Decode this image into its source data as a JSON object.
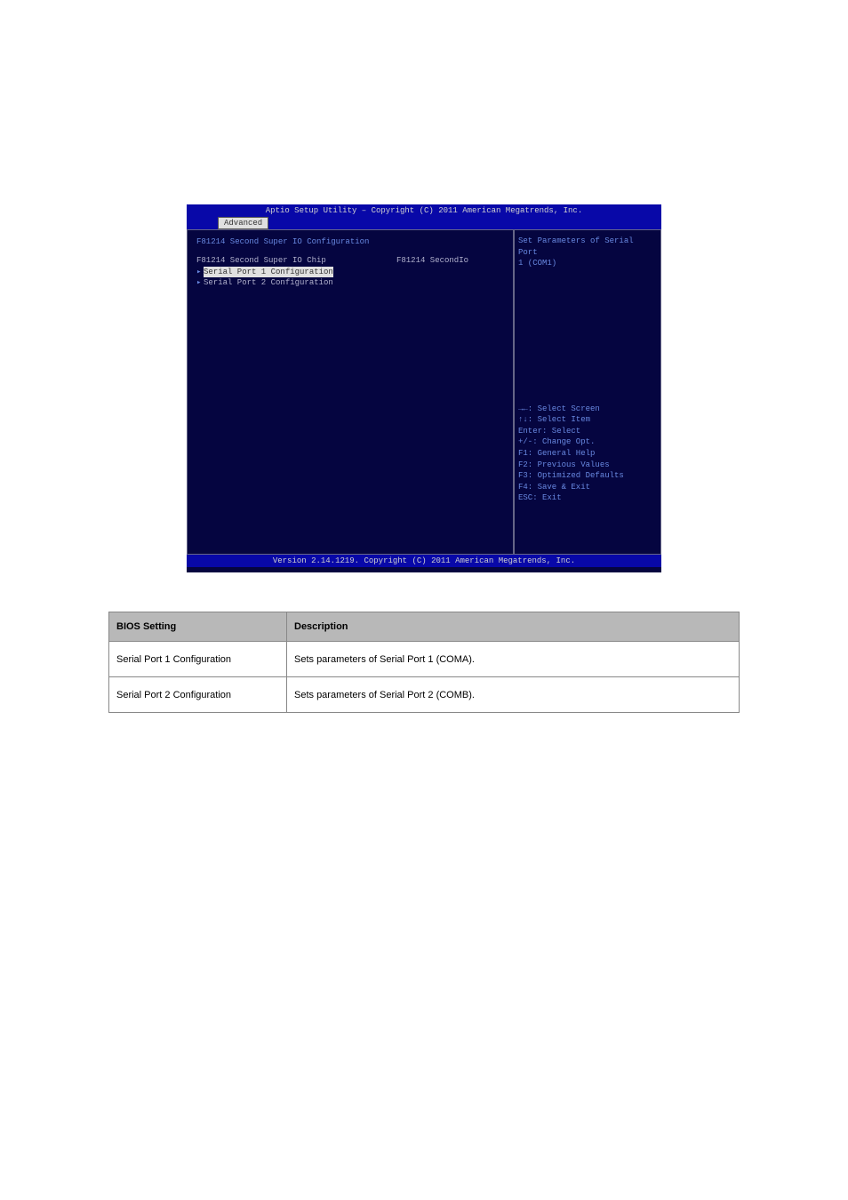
{
  "bios": {
    "title": "Aptio Setup Utility – Copyright (C) 2011 American Megatrends, Inc.",
    "tab": "Advanced",
    "section_heading": "F81214 Second Super IO Configuration",
    "chip_label": "F81214 Second Super IO Chip",
    "chip_value": "F81214 SecondIo",
    "menu_item1": "Serial Port 1 Configuration",
    "menu_item2": "Serial Port 2 Configuration",
    "help_text_line1": "Set Parameters of Serial Port",
    "help_text_line2": "1 (COM1)",
    "keys": {
      "k1": "→←: Select Screen",
      "k2": "↑↓: Select Item",
      "k3": "Enter: Select",
      "k4": "+/-: Change Opt.",
      "k5": "F1: General Help",
      "k6": "F2: Previous Values",
      "k7": "F3: Optimized Defaults",
      "k8": "F4: Save & Exit",
      "k9": "ESC: Exit"
    },
    "footer": "Version 2.14.1219. Copyright (C) 2011 American Megatrends, Inc."
  },
  "table": {
    "header1": "BIOS Setting",
    "header2": "Description",
    "row1_setting": "Serial Port 1 Configuration",
    "row1_desc": "Sets parameters of Serial Port 1 (COMA).",
    "row2_setting": "Serial Port 2 Configuration",
    "row2_desc": "Sets parameters of Serial Port 2 (COMB)."
  }
}
